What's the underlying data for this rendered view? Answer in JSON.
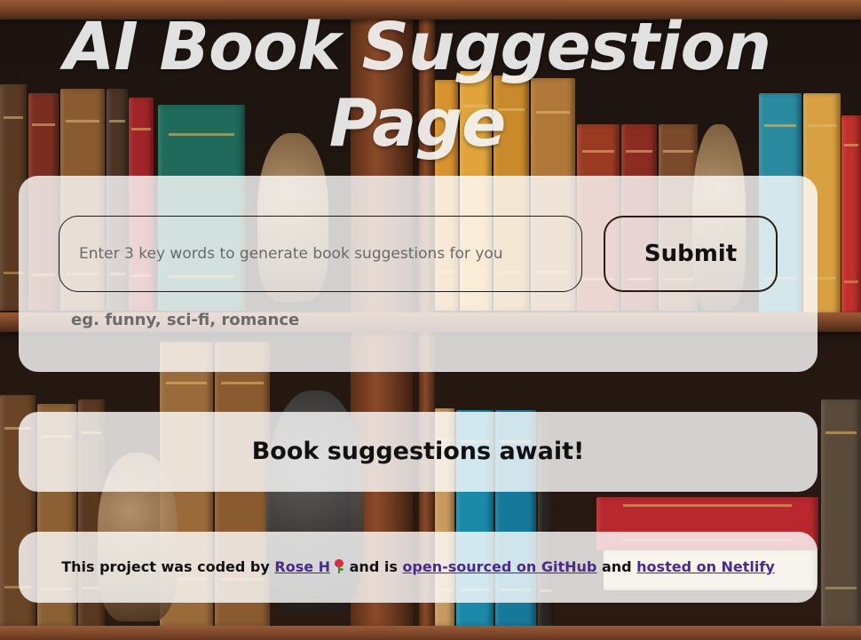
{
  "header": {
    "title": "AI Book Suggestion Page"
  },
  "search": {
    "placeholder": "Enter 3 key words to generate book suggestions for you",
    "value": "",
    "submit_label": "Submit",
    "hint": "eg. funny, sci-fi, romance"
  },
  "results": {
    "message": "Book suggestions await!"
  },
  "footer": {
    "prefix": "This project was coded by",
    "author_link": "Rose H",
    "author_icon": "rose-icon",
    "middle": "and is",
    "github_link": "open-sourced on GitHub",
    "joiner": "and",
    "netlify_link": "hosted on Netlify"
  },
  "colors": {
    "card_background": "rgba(255,255,255,0.80)",
    "text": "#111111",
    "hint": "#6b6b6b",
    "link": "#4b2a8c",
    "shelf_wood": "#8a4a28"
  }
}
